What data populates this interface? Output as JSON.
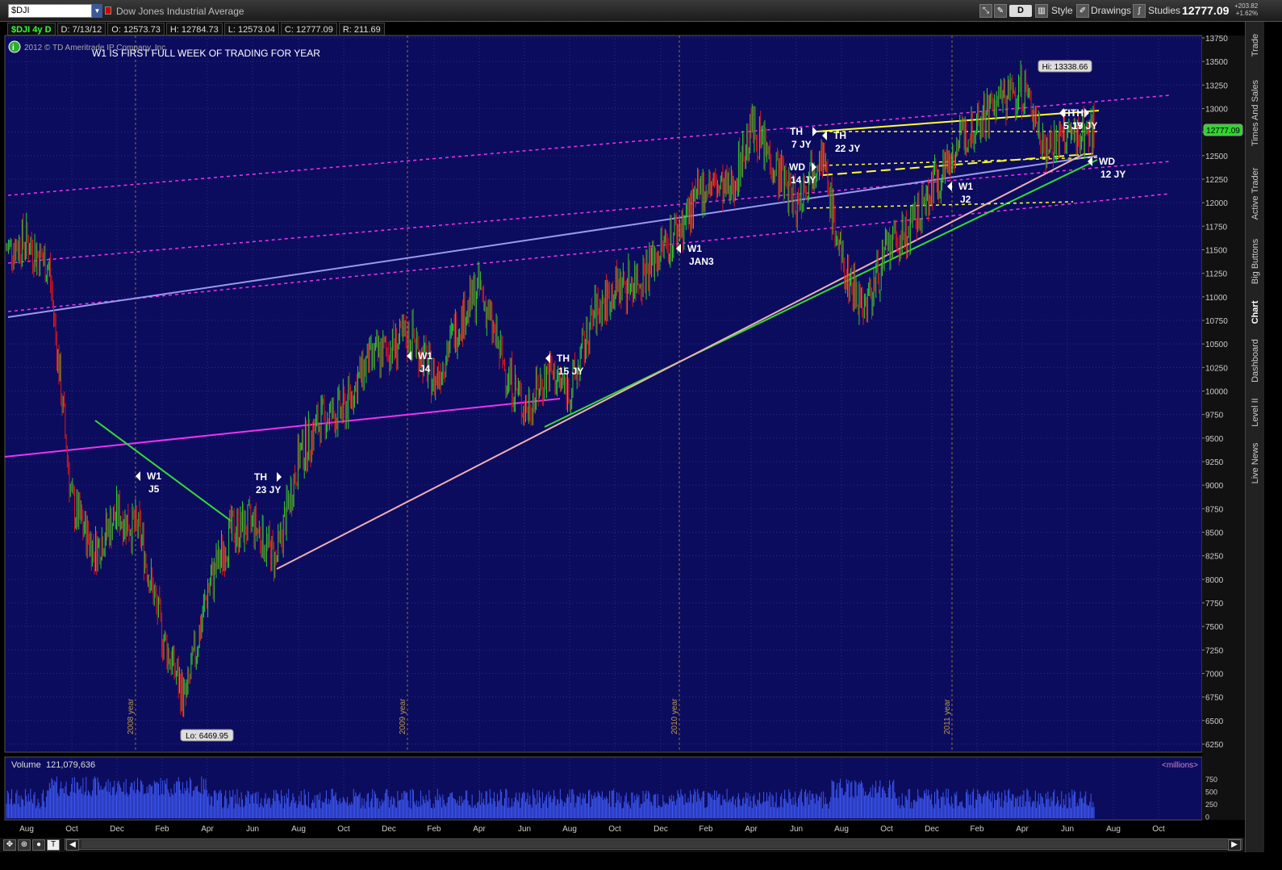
{
  "toolbar": {
    "symbol": "$DJI",
    "symbol_description": "Dow Jones Industrial Average",
    "period_label": "D",
    "style_label": "Style",
    "drawings_label": "Drawings",
    "studies_label": "Studies",
    "last_price": "12777.09",
    "net_change": "+203.82",
    "net_change_pct": "+1.62%"
  },
  "info_bar": {
    "symbol_period": "$DJI 4y D",
    "date": "D: 7/13/12",
    "open": "O: 12573.73",
    "high": "H: 12784.73",
    "low": "L: 12573.04",
    "close": "C: 12777.09",
    "range": "R: 211.69"
  },
  "chart": {
    "copyright": "2012 © TD Ameritrade IP Company, Inc.",
    "note": "W1 IS FIRST FULL  WEEK OF TRADING FOR YEAR",
    "hi_label": "Hi: 13338.66",
    "lo_label": "Lo: 6469.95",
    "price_badge": "12777.09",
    "volume_label": "Volume",
    "volume_value": "121,079,636",
    "volume_units": "<millions>",
    "colors": {
      "background": "#0c0c5e",
      "up": "#2ecc2e",
      "down": "#e01818",
      "magenta": "#ee33ee",
      "lavender": "#9999ee",
      "green": "#33dd33",
      "pink": "#f0b0b0",
      "yellow": "#ffff33",
      "volume": "#3b55ee"
    },
    "annotations": [
      {
        "line1": "W1",
        "line2": "J5"
      },
      {
        "line1": "TH",
        "line2": "23 JY"
      },
      {
        "line1": "W1",
        "line2": "J4"
      },
      {
        "line1": "TH",
        "line2": "15 JY"
      },
      {
        "line1": "W1",
        "line2": "JAN3"
      },
      {
        "line1": "TH",
        "line2": "7 JY"
      },
      {
        "line1": "TH",
        "line2": "22 JY"
      },
      {
        "line1": "WD",
        "line2": "14 JY"
      },
      {
        "line1": "W1",
        "line2": "J2"
      },
      {
        "line1": "TH",
        "line2": "5 JY"
      },
      {
        "line1": "TH",
        "line2": "19 JY"
      },
      {
        "line1": "WD",
        "line2": "12 JY"
      }
    ]
  },
  "chart_data": {
    "type": "candlestick",
    "title": "Dow Jones Industrial Average",
    "y_ticks": [
      13750,
      13500,
      13250,
      13000,
      12750,
      12500,
      12250,
      12000,
      11750,
      11500,
      11250,
      11000,
      10750,
      10500,
      10250,
      10000,
      9750,
      9500,
      9250,
      9000,
      8750,
      8500,
      8250,
      8000,
      7750,
      7500,
      7250,
      7000,
      6750,
      6500,
      6250
    ],
    "x_ticks": [
      "Aug",
      "Oct",
      "Dec",
      "Feb",
      "Apr",
      "Jun",
      "Aug",
      "Oct",
      "Dec",
      "Feb",
      "Apr",
      "Jun",
      "Aug",
      "Oct",
      "Dec",
      "Feb",
      "Apr",
      "Jun",
      "Aug",
      "Oct",
      "Dec",
      "Feb",
      "Apr",
      "Jun",
      "Aug",
      "Oct"
    ],
    "year_labels": [
      "2008 year",
      "2009 year",
      "2010 year",
      "2011 year"
    ],
    "volume_ticks": [
      750,
      500,
      250,
      0
    ],
    "price_path": [
      [
        "Jul 2008",
        11500
      ],
      [
        "Aug 2008",
        11600
      ],
      [
        "Sep 2008",
        11300
      ],
      [
        "Oct 2008",
        8800
      ],
      [
        "Nov 2008",
        8300
      ],
      [
        "Dec 2008",
        8700
      ],
      [
        "Jan 2009",
        8500
      ],
      [
        "Feb 2009",
        7400
      ],
      [
        "Mar 2009",
        6700
      ],
      [
        "Apr 2009",
        7900
      ],
      [
        "May 2009",
        8500
      ],
      [
        "Jun 2009",
        8600
      ],
      [
        "Jul 2009",
        8200
      ],
      [
        "Aug 2009",
        9300
      ],
      [
        "Sep 2009",
        9700
      ],
      [
        "Oct 2009",
        9800
      ],
      [
        "Nov 2009",
        10300
      ],
      [
        "Dec 2009",
        10450
      ],
      [
        "Jan 2010",
        10600
      ],
      [
        "Feb 2010",
        10100
      ],
      [
        "Mar 2010",
        10700
      ],
      [
        "Apr 2010",
        11100
      ],
      [
        "May 2010",
        10300
      ],
      [
        "Jun 2010",
        9800
      ],
      [
        "Jul 2010",
        10200
      ],
      [
        "Aug 2010",
        10000
      ],
      [
        "Sep 2010",
        10800
      ],
      [
        "Oct 2010",
        11100
      ],
      [
        "Nov 2010",
        11200
      ],
      [
        "Dec 2010",
        11500
      ],
      [
        "Jan 2011",
        11800
      ],
      [
        "Feb 2011",
        12200
      ],
      [
        "Mar 2011",
        12100
      ],
      [
        "Apr 2011",
        12800
      ],
      [
        "May 2011",
        12400
      ],
      [
        "Jun 2011",
        12000
      ],
      [
        "Jul 2011",
        12600
      ],
      [
        "Aug 2011",
        11300
      ],
      [
        "Sep 2011",
        10900
      ],
      [
        "Oct 2011",
        11500
      ],
      [
        "Nov 2011",
        11700
      ],
      [
        "Dec 2011",
        12200
      ],
      [
        "Jan 2012",
        12600
      ],
      [
        "Feb 2012",
        12900
      ],
      [
        "Mar 2012",
        13100
      ],
      [
        "Apr 2012",
        13200
      ],
      [
        "May 2012",
        12600
      ],
      [
        "Jun 2012",
        12700
      ],
      [
        "Jul 2012",
        12777
      ]
    ],
    "hi": 13338.66,
    "lo": 6469.95,
    "last": 12777.09,
    "grid": true,
    "ylim": [
      6150,
      13800
    ]
  },
  "right_tabs": [
    "Trade",
    "Times And Sales",
    "Active Trader",
    "Big Buttons",
    "Chart",
    "Dashboard",
    "Level II",
    "Live News"
  ]
}
